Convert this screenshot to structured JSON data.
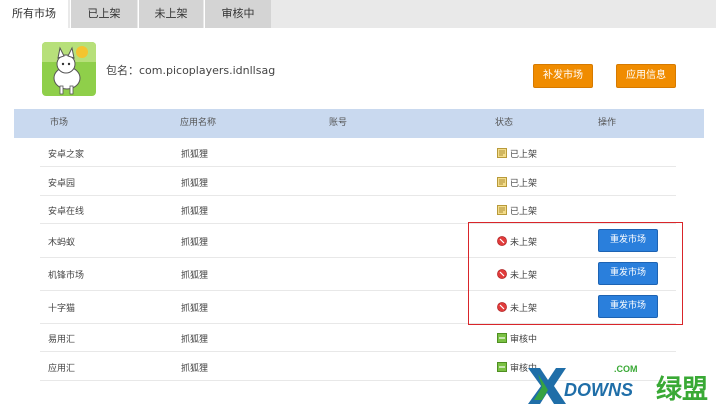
{
  "tabs": [
    {
      "label": "所有市场",
      "active": true
    },
    {
      "label": "已上架",
      "active": false
    },
    {
      "label": "未上架",
      "active": false
    },
    {
      "label": "审核中",
      "active": false
    }
  ],
  "app": {
    "package_label": "包名：com.picoplayers.idnllsag",
    "icon": "fox-cartoon-icon"
  },
  "buttons": {
    "resend_market": "补发市场",
    "app_info": "应用信息"
  },
  "table": {
    "headers": [
      "市场",
      "应用名称",
      "账号",
      "状态",
      "操作"
    ],
    "rows": [
      {
        "market": "安卓之家",
        "app_name": "抓狐狸",
        "account": "",
        "status": "已上架",
        "status_icon": "document-icon",
        "action": ""
      },
      {
        "market": "安卓园",
        "app_name": "抓狐狸",
        "account": "",
        "status": "已上架",
        "status_icon": "document-icon",
        "action": ""
      },
      {
        "market": "安卓在线",
        "app_name": "抓狐狸",
        "account": "",
        "status": "已上架",
        "status_icon": "document-icon",
        "action": ""
      },
      {
        "market": "木蚂蚁",
        "app_name": "抓狐狸",
        "account": "",
        "status": "未上架",
        "status_icon": "red-alert-icon",
        "action": "重发市场"
      },
      {
        "market": "机锋市场",
        "app_name": "抓狐狸",
        "account": "",
        "status": "未上架",
        "status_icon": "red-alert-icon",
        "action": "重发市场"
      },
      {
        "market": "十字猫",
        "app_name": "抓狐狸",
        "account": "",
        "status": "未上架",
        "status_icon": "red-alert-icon",
        "action": "重发市场"
      },
      {
        "market": "易用汇",
        "app_name": "抓狐狸",
        "account": "",
        "status": "审核中",
        "status_icon": "green-pending-icon",
        "action": ""
      },
      {
        "market": "应用汇",
        "app_name": "抓狐狸",
        "account": "",
        "status": "审核中",
        "status_icon": "green-pending-icon",
        "action": ""
      }
    ]
  },
  "watermark": {
    "brand_top": ".COM",
    "brand": "DOWNS",
    "brand_cn": "绿盟"
  },
  "colors": {
    "header_bg": "#c9d9ef",
    "orange_button": "#f08c00",
    "blue_button": "#2a7fdc",
    "highlight_border": "#d9252a"
  }
}
